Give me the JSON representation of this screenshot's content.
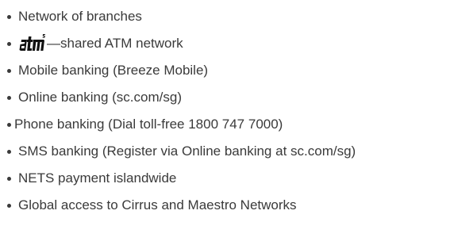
{
  "items": [
    {
      "text": "Network of branches"
    },
    {
      "logo": "atm5-logo",
      "text": "—shared ATM network"
    },
    {
      "text": "Mobile banking (Breeze Mobile)"
    },
    {
      "text": "Online banking (sc.com/sg)"
    },
    {
      "text": "Phone banking (Dial toll-free 1800 747 7000)"
    },
    {
      "text": "SMS banking (Register via Online banking at sc.com/sg)"
    },
    {
      "text": "NETS payment islandwide"
    },
    {
      "text": "Global access to Cirrus and Maestro Networks"
    }
  ],
  "colors": {
    "text": "#3a3a3a",
    "background": "#ffffff",
    "logo": "#111111"
  }
}
